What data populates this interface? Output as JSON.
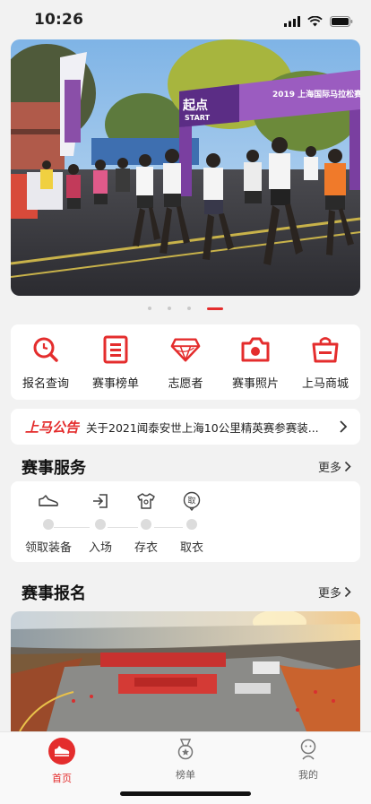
{
  "status_bar": {
    "time": "10:26"
  },
  "banner": {
    "slide_count": 4,
    "active_index": 3,
    "start_sign": "起点",
    "start_sign_en": "START",
    "arch_text": "2019 上海国际马拉松赛"
  },
  "quick_menu": [
    {
      "label": "报名查询",
      "icon": "search-icon"
    },
    {
      "label": "赛事榜单",
      "icon": "list-icon"
    },
    {
      "label": "志愿者",
      "icon": "diamond-icon"
    },
    {
      "label": "赛事照片",
      "icon": "camera-icon"
    },
    {
      "label": "上马商城",
      "icon": "shopping-bag-icon"
    }
  ],
  "notice": {
    "brand": "上马公告",
    "text": "关于2021闻泰安世上海10公里精英赛参赛装..."
  },
  "services": {
    "title": "赛事服务",
    "more": "更多",
    "steps": [
      {
        "label": "领取装备",
        "icon": "shoe-icon"
      },
      {
        "label": "入场",
        "icon": "enter-icon"
      },
      {
        "label": "存衣",
        "icon": "shirt-icon"
      },
      {
        "label": "取衣",
        "icon": "pickup-icon",
        "glyph": "取"
      }
    ]
  },
  "registration": {
    "title": "赛事报名",
    "more": "更多"
  },
  "tabbar": [
    {
      "label": "首页",
      "active": true
    },
    {
      "label": "榜单",
      "active": false
    },
    {
      "label": "我的",
      "active": false
    }
  ],
  "colors": {
    "accent": "#e42d2d",
    "background": "#f2f2f2"
  }
}
